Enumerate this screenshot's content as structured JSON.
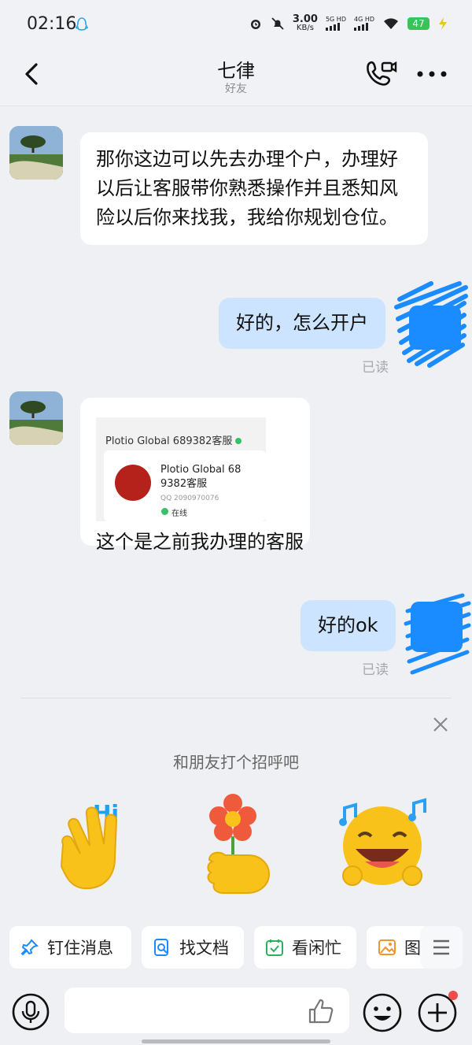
{
  "status_bar": {
    "time": "02:16",
    "net_speed_value": "3.00",
    "net_speed_unit": "KB/s",
    "sim1": "5G HD",
    "sim2": "4G HD",
    "battery": "47"
  },
  "header": {
    "title": "七律",
    "subtitle": "好友"
  },
  "messages": [
    {
      "side": "left",
      "text": "那你这边可以先去办理个户，办理好以后让客服带你熟悉操作并且悉知风险以后你来找我，我给你规划仓位。"
    },
    {
      "side": "right",
      "text": "好的，怎么开户",
      "read": "已读"
    },
    {
      "side": "left",
      "image": {
        "header": "Plotio Global 689382客服",
        "name_line1": "Plotio Global 68",
        "name_line2": "9382客服",
        "qq": "QQ 2090970076",
        "status": "在线"
      },
      "text": "这个是之前我办理的客服"
    },
    {
      "side": "right",
      "text": "好的ok",
      "read": "已读"
    }
  ],
  "greeting": {
    "text": "和朋友打个招呼吧",
    "emojis": [
      "waving-hand-hi",
      "flower-hand",
      "happy-music-face"
    ]
  },
  "quick_chips": [
    {
      "label": "钉住消息",
      "icon": "pin-icon"
    },
    {
      "label": "找文档",
      "icon": "document-search-icon"
    },
    {
      "label": "看闲忙",
      "icon": "calendar-check-icon"
    },
    {
      "label": "图",
      "icon": "image-icon"
    }
  ],
  "colors": {
    "accent": "#1a8cff",
    "bubble_right": "#cce4ff",
    "bubble_left": "#ffffff",
    "background": "#eef0f3"
  }
}
